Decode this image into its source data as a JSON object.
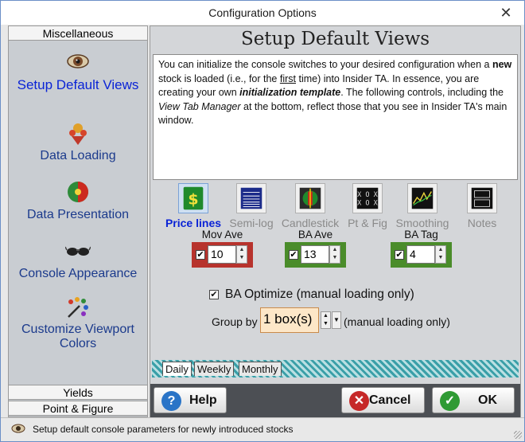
{
  "window": {
    "title": "Configuration Options",
    "close_glyph": "✕"
  },
  "sidebar": {
    "top_header": "Miscellaneous",
    "items": [
      {
        "label": "Setup Default Views",
        "icon": "eye-icon",
        "active": true
      },
      {
        "label": "Data Loading",
        "icon": "data-loading-icon"
      },
      {
        "label": "Data Presentation",
        "icon": "data-presentation-icon"
      },
      {
        "label": "Console Appearance",
        "icon": "sunglasses-icon"
      },
      {
        "label": "Customize Viewport Colors",
        "icon": "palette-icon"
      }
    ],
    "bottom_headers": [
      "Yields",
      "Point & Figure"
    ]
  },
  "main": {
    "title": "Setup Default Views",
    "description": {
      "p1": "You can initialize the console switches to your desired configuration when a ",
      "new": "new",
      "p2": " stock is loaded (i.e., for the ",
      "first": "first",
      "p3": " time) into Insider TA. In essence, you are creating your own ",
      "init_template": "initialization template",
      "p4": ". The following controls, including the ",
      "vtm": "View Tab Manager",
      "p5": " at the bottom, reflect those that you see in Insider TA's main window."
    },
    "switches": [
      {
        "label": "Price lines",
        "icon": "dollar-icon",
        "active": true
      },
      {
        "label": "Semi-log",
        "icon": "semilog-icon"
      },
      {
        "label": "Candlestick",
        "icon": "candlestick-icon"
      },
      {
        "label": "Pt & Fig",
        "icon": "point-figure-icon"
      },
      {
        "label": "Smoothing",
        "icon": "smoothing-icon"
      },
      {
        "label": "Notes",
        "icon": "notes-icon"
      }
    ],
    "moving_averages": [
      {
        "label": "Mov Ave",
        "value": "10",
        "checked": true,
        "color": "#b7332d"
      },
      {
        "label": "BA Ave",
        "value": "13",
        "checked": true,
        "color": "#4a8c2a"
      },
      {
        "label": "BA Tag",
        "value": "4",
        "checked": true,
        "color": "#4a8c2a"
      }
    ],
    "ba_optimize": {
      "label": "BA Optimize (manual loading only)",
      "checked": true
    },
    "group_by": {
      "label": "Group by",
      "value": "1 box(s)",
      "suffix": "(manual loading only)"
    },
    "tabs": [
      "Daily",
      "Weekly",
      "Monthly"
    ],
    "buttons": {
      "help": "Help",
      "cancel": "Cancel",
      "ok": "OK"
    }
  },
  "status": {
    "text": "Setup default console parameters for newly introduced stocks"
  },
  "colors": {
    "accent_blue": "#0a23d6",
    "button_bar": "#4c4f54",
    "tabs_teal": "#3a9fa8"
  }
}
